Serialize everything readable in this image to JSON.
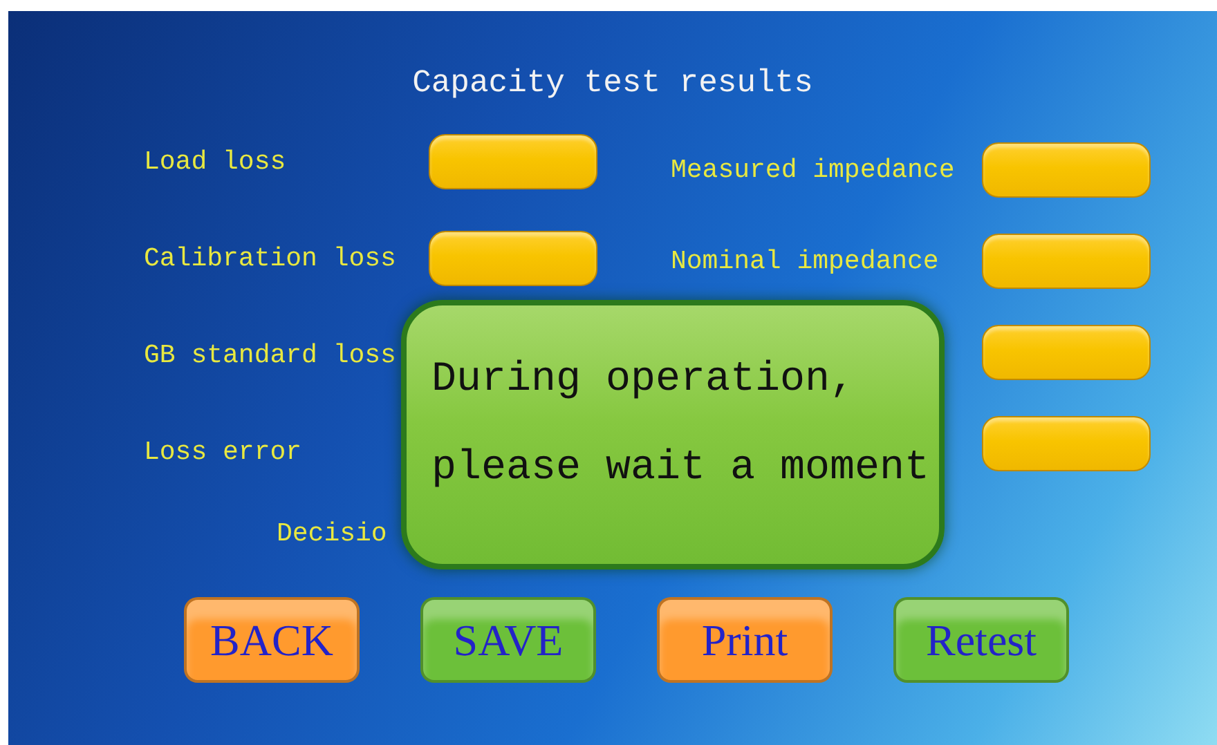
{
  "screen": {
    "title": "Capacity test results"
  },
  "left_fields": [
    {
      "label": "Load loss"
    },
    {
      "label": "Calibration loss"
    },
    {
      "label": "GB standard loss"
    },
    {
      "label": "Loss error"
    }
  ],
  "right_fields": [
    {
      "kind": "labeled",
      "label": "Measured impedance"
    },
    {
      "kind": "labeled",
      "label": "Nominal impedance"
    },
    {
      "kind": "bare"
    },
    {
      "kind": "bare"
    }
  ],
  "decision": {
    "label": "Decisio"
  },
  "dialog": {
    "message": "During operation, please wait a moment"
  },
  "buttons": [
    {
      "label": "BACK",
      "color": "#ff9a2e"
    },
    {
      "label": "SAVE",
      "color": "#6cc03a"
    },
    {
      "label": "Print",
      "color": "#ff9a2e"
    },
    {
      "label": "Retest",
      "color": "#6cc03a"
    }
  ]
}
